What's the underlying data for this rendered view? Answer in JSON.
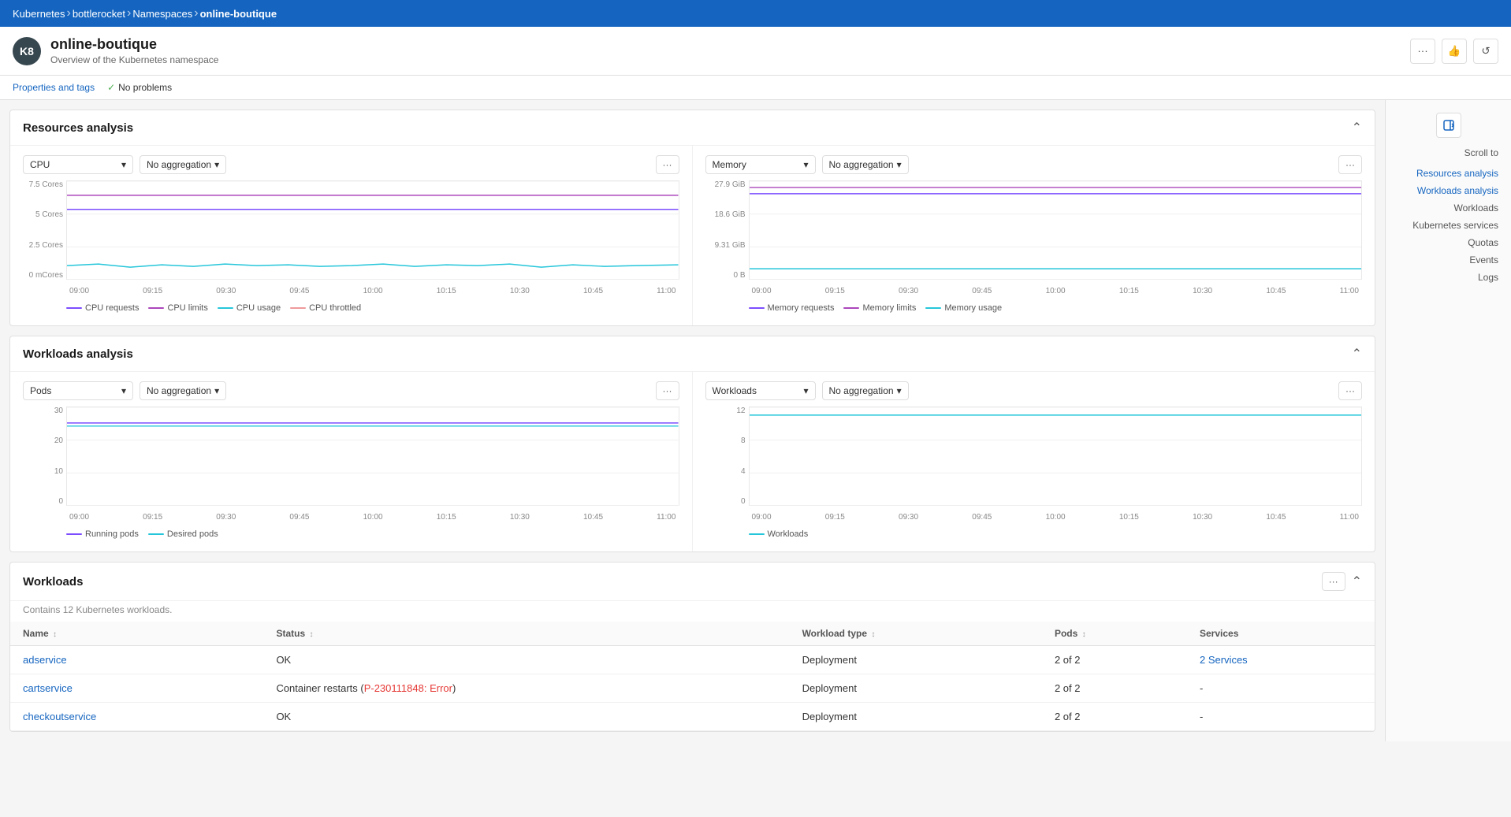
{
  "breadcrumb": {
    "items": [
      {
        "label": "Kubernetes",
        "active": false
      },
      {
        "label": "bottlerocket",
        "active": false
      },
      {
        "label": "Namespaces",
        "active": false
      },
      {
        "label": "online-boutique",
        "active": true
      }
    ]
  },
  "header": {
    "icon": "K8",
    "title": "online-boutique",
    "subtitle": "Overview of the Kubernetes namespace",
    "menu_label": "···",
    "like_label": "👍",
    "refresh_label": "↺"
  },
  "statusBar": {
    "properties_label": "Properties and tags",
    "status_label": "No problems"
  },
  "resources_analysis": {
    "title": "Resources analysis",
    "cpu_chart": {
      "select_label": "CPU",
      "aggregation_label": "No aggregation",
      "more_label": "···",
      "y_labels": [
        "7.5 Cores",
        "5 Cores",
        "2.5 Cores",
        "0 mCores"
      ],
      "x_labels": [
        "09:00",
        "09:15",
        "09:30",
        "09:45",
        "10:00",
        "10:15",
        "10:30",
        "10:45",
        "11:00"
      ],
      "legend": [
        {
          "label": "CPU requests",
          "color": "#7c4dff"
        },
        {
          "label": "CPU limits",
          "color": "#ab47bc"
        },
        {
          "label": "CPU usage",
          "color": "#26c6da"
        },
        {
          "label": "CPU throttled",
          "color": "#ef9a9a"
        }
      ]
    },
    "memory_chart": {
      "select_label": "Memory",
      "aggregation_label": "No aggregation",
      "more_label": "···",
      "y_labels": [
        "27.9 GiB",
        "18.6 GiB",
        "9.31 GiB",
        "0 B"
      ],
      "x_labels": [
        "09:00",
        "09:15",
        "09:30",
        "09:45",
        "10:00",
        "10:15",
        "10:30",
        "10:45",
        "11:00"
      ],
      "legend": [
        {
          "label": "Memory requests",
          "color": "#7c4dff"
        },
        {
          "label": "Memory limits",
          "color": "#ab47bc"
        },
        {
          "label": "Memory usage",
          "color": "#26c6da"
        }
      ]
    }
  },
  "workloads_analysis": {
    "title": "Workloads analysis",
    "pods_chart": {
      "select_label": "Pods",
      "aggregation_label": "No aggregation",
      "more_label": "···",
      "y_labels": [
        "30",
        "20",
        "10",
        "0"
      ],
      "x_labels": [
        "09:00",
        "09:15",
        "09:30",
        "09:45",
        "10:00",
        "10:15",
        "10:30",
        "10:45",
        "11:00"
      ],
      "legend": [
        {
          "label": "Running pods",
          "color": "#7c4dff"
        },
        {
          "label": "Desired pods",
          "color": "#26c6da"
        }
      ]
    },
    "workloads_chart": {
      "select_label": "Workloads",
      "aggregation_label": "No aggregation",
      "more_label": "···",
      "y_labels": [
        "12",
        "8",
        "4",
        "0"
      ],
      "x_labels": [
        "09:00",
        "09:15",
        "09:30",
        "09:45",
        "10:00",
        "10:15",
        "10:30",
        "10:45",
        "11:00"
      ],
      "legend": [
        {
          "label": "Workloads",
          "color": "#26c6da"
        }
      ]
    }
  },
  "workloads_section": {
    "title": "Workloads",
    "subtitle": "Contains 12 Kubernetes workloads.",
    "more_label": "···",
    "columns": [
      {
        "label": "Name",
        "sort": "↕"
      },
      {
        "label": "Status",
        "sort": "↕"
      },
      {
        "label": "Workload type",
        "sort": "↕"
      },
      {
        "label": "Pods",
        "sort": "↕"
      },
      {
        "label": "Services"
      }
    ],
    "rows": [
      {
        "name": "adservice",
        "name_link": true,
        "status": "OK",
        "status_type": "ok",
        "workload_type": "Deployment",
        "pods": "2 of 2",
        "services": "2 Services",
        "services_link": true
      },
      {
        "name": "cartservice",
        "name_link": true,
        "status": "Container restarts (P-230111848: Error)",
        "status_type": "error",
        "workload_type": "Deployment",
        "pods": "2 of 2",
        "services": "-",
        "services_link": false
      },
      {
        "name": "checkoutservice",
        "name_link": true,
        "status": "OK",
        "status_type": "ok",
        "workload_type": "Deployment",
        "pods": "2 of 2",
        "services": "-",
        "services_link": false
      }
    ]
  },
  "scroll_to": {
    "title": "Scroll to",
    "items": [
      {
        "label": "Resources analysis",
        "link": true
      },
      {
        "label": "Workloads analysis",
        "link": true
      },
      {
        "label": "Workloads",
        "link": false
      },
      {
        "label": "Kubernetes services",
        "link": false
      },
      {
        "label": "Quotas",
        "link": false
      },
      {
        "label": "Events",
        "link": false
      },
      {
        "label": "Logs",
        "link": false
      }
    ]
  }
}
